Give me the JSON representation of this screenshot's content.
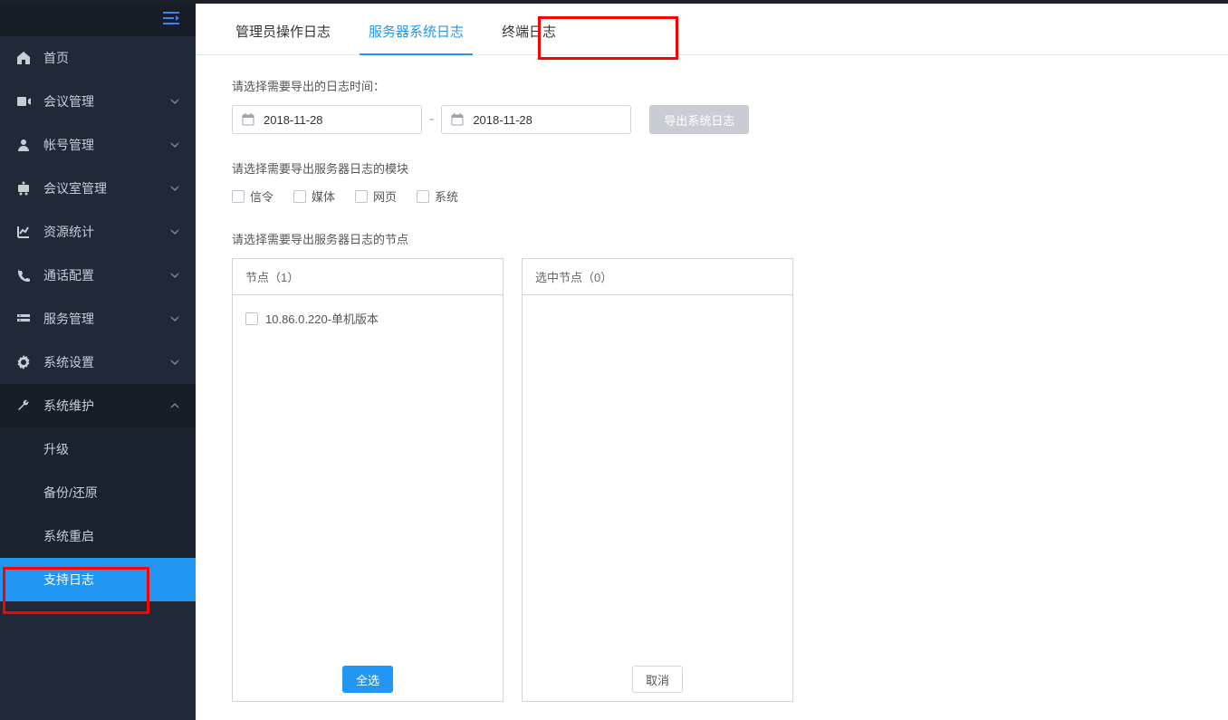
{
  "sidebar": {
    "items": [
      {
        "icon": "home",
        "label": "首页",
        "expandable": false
      },
      {
        "icon": "meeting",
        "label": "会议管理",
        "expandable": true
      },
      {
        "icon": "account",
        "label": "帐号管理",
        "expandable": true
      },
      {
        "icon": "room",
        "label": "会议室管理",
        "expandable": true
      },
      {
        "icon": "stats",
        "label": "资源统计",
        "expandable": true
      },
      {
        "icon": "phone",
        "label": "通话配置",
        "expandable": true
      },
      {
        "icon": "service",
        "label": "服务管理",
        "expandable": true
      },
      {
        "icon": "gear",
        "label": "系统设置",
        "expandable": true
      },
      {
        "icon": "wrench",
        "label": "系统维护",
        "expandable": true,
        "expanded": true
      }
    ],
    "subitems": [
      {
        "label": "升级"
      },
      {
        "label": "备份/还原"
      },
      {
        "label": "系统重启"
      },
      {
        "label": "支持日志",
        "active": true
      }
    ]
  },
  "tabs": [
    {
      "label": "管理员操作日志",
      "active": false
    },
    {
      "label": "服务器系统日志",
      "active": true
    },
    {
      "label": "终端日志",
      "active": false
    }
  ],
  "content": {
    "date_section_label": "请选择需要导出的日志时间：",
    "date_from": "2018-11-28",
    "date_to": "2018-11-28",
    "date_separator": "-",
    "export_button": "导出系统日志",
    "module_section_label": "请选择需要导出服务器日志的模块",
    "modules": [
      {
        "label": "信令"
      },
      {
        "label": "媒体"
      },
      {
        "label": "网页"
      },
      {
        "label": "系统"
      }
    ],
    "node_section_label": "请选择需要导出服务器日志的节点",
    "left_panel": {
      "header": "节点（1）",
      "items": [
        {
          "label": "10.86.0.220-单机版本"
        }
      ],
      "footer_button": "全选"
    },
    "right_panel": {
      "header": "选中节点（0）",
      "footer_button": "取消"
    }
  }
}
